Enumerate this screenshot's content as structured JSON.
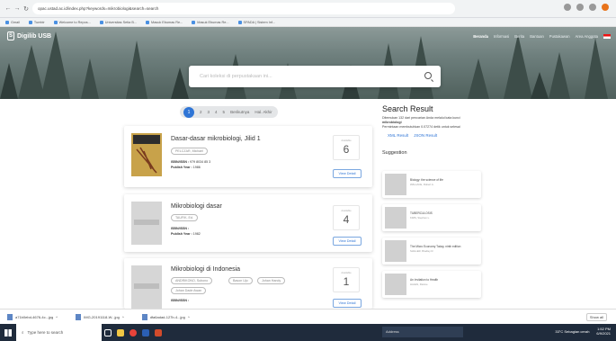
{
  "browser": {
    "url": "opac.ustad.ac.id/index.php?keywords=mikrobiologi&search=search",
    "bookmarks": [
      "Gmail",
      "Tumblr",
      "Welcome to Repos...",
      "Universitas Setia B...",
      "Masuk Ebumas Re...",
      "Masuk Ebumas Re...",
      "SPADA | Sistem Inf..."
    ]
  },
  "site": {
    "logo": "Digilib USB",
    "nav": [
      "Beranda",
      "Informasi",
      "Berita",
      "Bantuan",
      "Pustakawan",
      "Area Anggota"
    ],
    "search_placeholder": "Cari koleksi di perpustakaan ini..."
  },
  "pagination": {
    "pages": [
      "1",
      "2",
      "3",
      "4",
      "5"
    ],
    "next": "Berikutnya",
    "last": "Hal. Akhir"
  },
  "results": [
    {
      "title": "Dasar-dasar mikrobiologi, Jilid 1",
      "authors": [
        "PELCZAR, Michael"
      ],
      "isbn_label": "ISBN/ISSN :",
      "isbn": "979 8034 85 3",
      "year_label": "Publish Year :",
      "year": "1986",
      "avail_label": "Available",
      "avail": "6",
      "detail": "View Detail"
    },
    {
      "title": "Mikrobiologi dasar",
      "authors": [
        "TAUFIK, Ed."
      ],
      "isbn_label": "ISBN/ISSN :",
      "isbn": "",
      "year_label": "Publish Year :",
      "year": "1982",
      "avail_label": "Available",
      "avail": "4",
      "detail": "View Detail"
    },
    {
      "title": "Mikrobiologi di Indonesia",
      "authors": [
        "ANDRIKONO, Subono",
        "Bason Ujo",
        "Johan Handy",
        "Johan Dade Awan"
      ],
      "isbn_label": "ISBN/ISSN :",
      "isbn": "",
      "year_label": "",
      "year": "",
      "avail_label": "Available",
      "avail": "1",
      "detail": "View Detail"
    }
  ],
  "sidebar": {
    "title": "Search Result",
    "found_text": "Ditemukan 132 dari pencarian Anda melalui kata kunci",
    "keyword": "mikrobiologi",
    "time_text": "Permintaan membutuhkan 0.07274 detik untuk selesai",
    "links": [
      "XML Result",
      "JSON Result"
    ],
    "suggestion_title": "Suggestion",
    "suggestions": [
      {
        "title": "Biology: the science of life",
        "author": "WALLACE, Robert A."
      },
      {
        "title": "TUBERCULOSIS",
        "author": "KIMS, Stephen L."
      },
      {
        "title": "The Micro Economy Today, ninth edition",
        "author": "SHILLER, Bradley R."
      },
      {
        "title": "An Invitation to Health",
        "author": "HALES, Dianne"
      }
    ]
  },
  "downloads": [
    "a71b0ebd-4676-4c...jpg",
    "IMG-20191118-W...jpg",
    "dfa6adad-127b-4...jpg"
  ],
  "downloads_showall": "Show all",
  "taskbar": {
    "search": "Type here to search",
    "address": "Address",
    "weather": "33°C Sebagian cerah",
    "time": "1:52 PM",
    "date": "6/9/2021"
  }
}
